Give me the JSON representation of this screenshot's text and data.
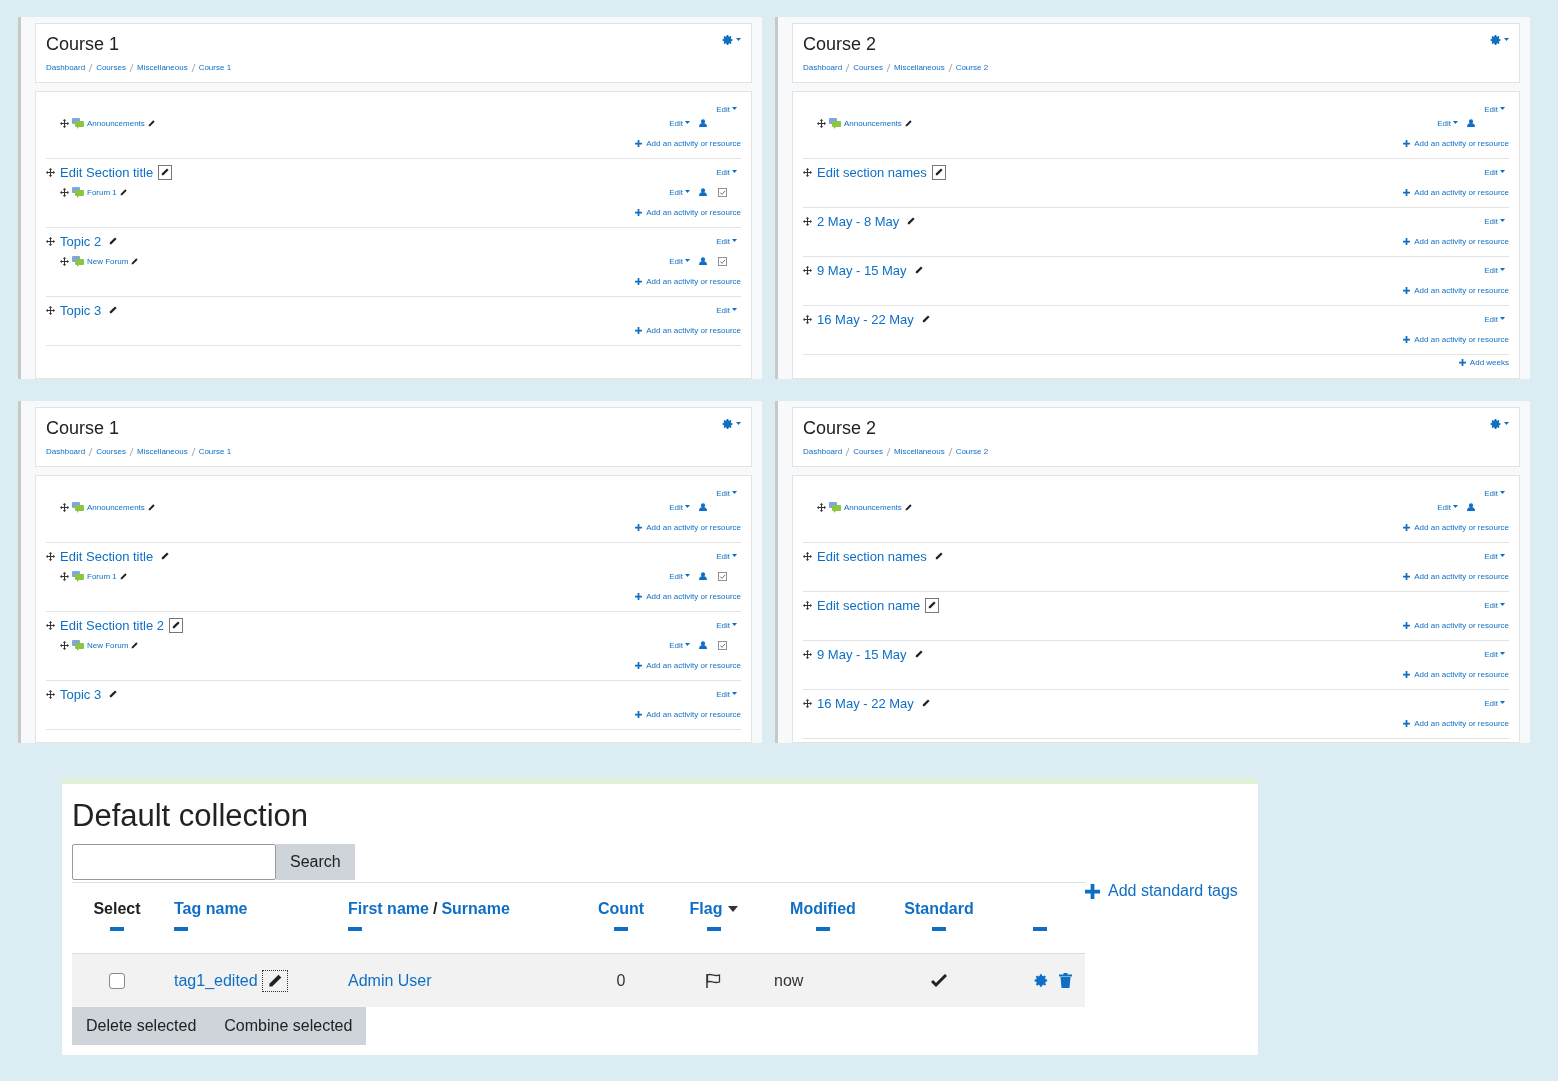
{
  "panels": [
    {
      "title": "Course 1",
      "breadcrumb": [
        "Dashboard",
        "Courses",
        "Miscellaneous",
        "Course 1"
      ],
      "sections": [
        {
          "edit": "Edit",
          "activities": [
            {
              "name": "Announcements",
              "edit": "Edit"
            }
          ],
          "add": "Add an activity or resource"
        },
        {
          "title": "Edit Section title",
          "pencil_boxed": true,
          "edit": "Edit",
          "activities": [
            {
              "name": "Forum 1",
              "edit": "Edit",
              "completion": true
            }
          ],
          "add": "Add an activity or resource"
        },
        {
          "title": "Topic 2",
          "pencil_boxed": false,
          "edit": "Edit",
          "activities": [
            {
              "name": "New Forum",
              "edit": "Edit",
              "completion": true
            }
          ],
          "add": "Add an activity or resource"
        },
        {
          "title": "Topic 3",
          "pencil_boxed": false,
          "edit": "Edit",
          "add": "Add an activity or resource"
        }
      ]
    },
    {
      "title": "Course 2",
      "breadcrumb": [
        "Dashboard",
        "Courses",
        "Miscellaneous",
        "Course 2"
      ],
      "sections": [
        {
          "edit": "Edit",
          "activities": [
            {
              "name": "Announcements",
              "edit": "Edit"
            }
          ],
          "add": "Add an activity or resource"
        },
        {
          "title": "Edit section names",
          "pencil_boxed": true,
          "edit": "Edit",
          "add": "Add an activity or resource"
        },
        {
          "title": "2 May - 8 May",
          "pencil_boxed": false,
          "edit": "Edit",
          "add": "Add an activity or resource"
        },
        {
          "title": "9 May - 15 May",
          "pencil_boxed": false,
          "edit": "Edit",
          "add": "Add an activity or resource"
        },
        {
          "title": "16 May - 22 May",
          "pencil_boxed": false,
          "edit": "Edit",
          "add": "Add an activity or resource"
        }
      ],
      "footer_link": "Add weeks"
    },
    {
      "title": "Course 1",
      "breadcrumb": [
        "Dashboard",
        "Courses",
        "Miscellaneous",
        "Course 1"
      ],
      "sections": [
        {
          "edit": "Edit",
          "activities": [
            {
              "name": "Announcements",
              "edit": "Edit"
            }
          ],
          "add": "Add an activity or resource"
        },
        {
          "title": "Edit Section title",
          "pencil_boxed": false,
          "edit": "Edit",
          "activities": [
            {
              "name": "Forum 1",
              "edit": "Edit",
              "completion": true
            }
          ],
          "add": "Add an activity or resource"
        },
        {
          "title": "Edit Section title 2",
          "pencil_boxed": true,
          "edit": "Edit",
          "activities": [
            {
              "name": "New Forum",
              "edit": "Edit",
              "completion": true
            }
          ],
          "add": "Add an activity or resource"
        },
        {
          "title": "Topic 3",
          "pencil_boxed": false,
          "edit": "Edit",
          "add": "Add an activity or resource"
        }
      ]
    },
    {
      "title": "Course 2",
      "breadcrumb": [
        "Dashboard",
        "Courses",
        "Miscellaneous",
        "Course 2"
      ],
      "sections": [
        {
          "edit": "Edit",
          "activities": [
            {
              "name": "Announcements",
              "edit": "Edit"
            }
          ],
          "add": "Add an activity or resource"
        },
        {
          "title": "Edit section names",
          "pencil_boxed": false,
          "edit": "Edit",
          "add": "Add an activity or resource"
        },
        {
          "title": "Edit section name",
          "pencil_boxed": true,
          "edit": "Edit",
          "add": "Add an activity or resource"
        },
        {
          "title": "9 May - 15 May",
          "pencil_boxed": false,
          "edit": "Edit",
          "add": "Add an activity or resource"
        },
        {
          "title": "16 May - 22 May",
          "pencil_boxed": false,
          "edit": "Edit",
          "add": "Add an activity or resource"
        }
      ]
    }
  ],
  "tags": {
    "title": "Default collection",
    "search_button": "Search",
    "add_link": "Add standard tags",
    "columns": [
      {
        "kind": "text",
        "label": "Select"
      },
      {
        "kind": "link",
        "label": "Tag name"
      },
      {
        "kind": "split",
        "links": [
          "First name",
          "Surname"
        ],
        "separator": "/"
      },
      {
        "kind": "link",
        "label": "Count"
      },
      {
        "kind": "link",
        "label": "Flag",
        "sorted": true
      },
      {
        "kind": "link",
        "label": "Modified"
      },
      {
        "kind": "link",
        "label": "Standard"
      },
      {
        "kind": "blank"
      }
    ],
    "rows": [
      {
        "checked": false,
        "tag": "tag1_edited",
        "pencil_boxed": true,
        "user": "Admin User",
        "count": "0",
        "flagged": false,
        "modified": "now",
        "standard": true
      }
    ],
    "buttons": [
      "Delete selected",
      "Combine selected"
    ]
  }
}
